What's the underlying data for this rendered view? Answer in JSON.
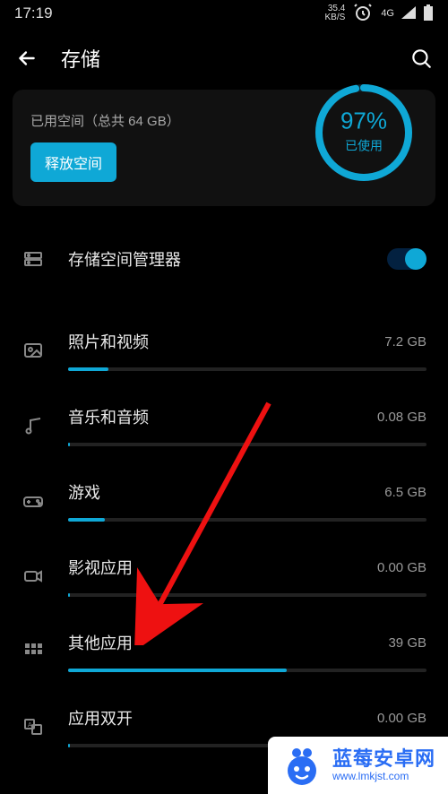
{
  "status": {
    "time": "17:19",
    "speed_top": "35.4",
    "speed_bottom": "KB/S",
    "signal_label": "4G"
  },
  "appbar": {
    "title": "存储"
  },
  "summary": {
    "used_line": "已用空间（总共 64 GB）",
    "free_btn": "释放空间",
    "ring_pct": "97%",
    "ring_label": "已使用",
    "ring_fraction": 0.97
  },
  "manager": {
    "label": "存储空间管理器",
    "on": true
  },
  "total_gb": 64,
  "categories": [
    {
      "icon": "photo-icon",
      "name": "照片和视频",
      "value": "7.2 GB",
      "gb": 7.2
    },
    {
      "icon": "music-icon",
      "name": "音乐和音频",
      "value": "0.08 GB",
      "gb": 0.08
    },
    {
      "icon": "games-icon",
      "name": "游戏",
      "value": "6.5 GB",
      "gb": 6.5
    },
    {
      "icon": "video-app-icon",
      "name": "影视应用",
      "value": "0.00 GB",
      "gb": 0.0
    },
    {
      "icon": "apps-grid-icon",
      "name": "其他应用",
      "value": "39 GB",
      "gb": 39.0
    },
    {
      "icon": "dual-app-icon",
      "name": "应用双开",
      "value": "0.00 GB",
      "gb": 0.0
    }
  ],
  "watermark": {
    "cn": "蓝莓安卓网",
    "en": "www.lmkjst.com"
  },
  "annotation_arrow_target": "其他应用"
}
